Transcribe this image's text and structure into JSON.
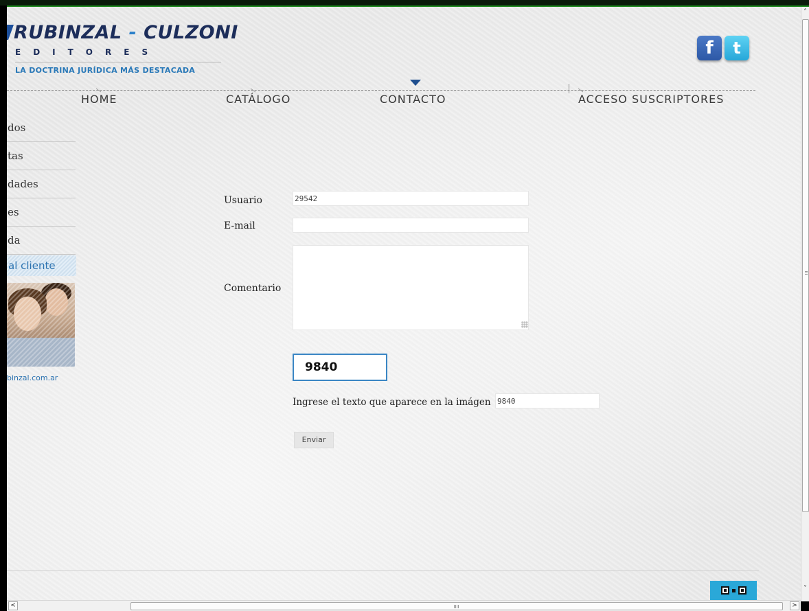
{
  "brand": {
    "name_part1": "RUBINZAL",
    "dash": "-",
    "name_part2": "CULZONI",
    "subtitle": "EDITORES",
    "tagline": "LA DOCTRINA JURÍDICA MÁS DESTACADA",
    "colors": {
      "navy": "#1c2d5a",
      "accent_blue": "#2a79b8"
    }
  },
  "social": {
    "facebook_glyph": "f",
    "twitter_glyph": "t"
  },
  "nav": {
    "items": [
      {
        "label": "HOME"
      },
      {
        "label": "CATÁLOGO"
      },
      {
        "label": "CONTACTO"
      },
      {
        "label": "ACCESO SUSCRIPTORES"
      }
    ],
    "active_item": "CONTACTO"
  },
  "sidebar": {
    "items": [
      {
        "label": "dos"
      },
      {
        "label": "tas"
      },
      {
        "label": "dades"
      },
      {
        "label": "es"
      },
      {
        "label": "da"
      }
    ],
    "client_label": "al cliente",
    "email_fragment": "binzal.com.ar"
  },
  "form": {
    "usuario_label": "Usuario",
    "usuario_value": "29542",
    "email_label": "E-mail",
    "email_value": "",
    "comentario_label": "Comentario",
    "comentario_value": "",
    "captcha_image_text": "9840",
    "captcha_prompt": "Ingrese el texto que aparece en la imágen",
    "captcha_value": "9840",
    "submit_label": "Enviar"
  },
  "scrollbars": {
    "up_arrow": "˄",
    "down_arrow": "˅",
    "left_arrow": "<",
    "right_arrow": ">"
  }
}
